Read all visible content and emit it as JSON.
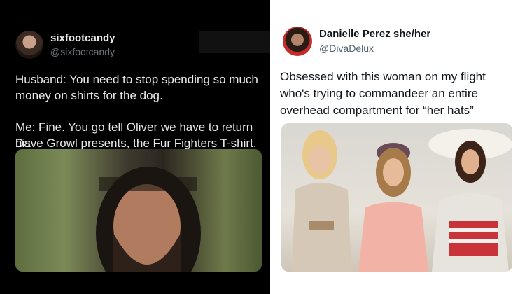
{
  "left_tweet": {
    "display_name": "sixfootcandy",
    "handle": "@sixfootcandy",
    "line1": "Husband: You need to stop spending so much",
    "line2": "money on shirts for the dog.",
    "line3": "Me: Fine. You go tell Oliver we have to return his",
    "line4": "Dave Growl presents, the Fur Fighters T-shirt.",
    "avatar_icon": "profile-photo",
    "photo_icon": "man-close-up-photo"
  },
  "right_tweet": {
    "display_name": "Danielle Perez she/her",
    "handle": "@DivaDelux",
    "line1": "Obsessed with this woman on my flight",
    "line2": "who's trying to commandeer an entire",
    "line3": "overhead compartment for “her hats”",
    "avatar_icon": "profile-photo",
    "photo_icon": "three-women-photo"
  },
  "colors": {
    "left_bg": "#000000",
    "right_bg": "#ffffff",
    "handle_gray": "#71767b",
    "right_handle_gray": "#536471"
  }
}
